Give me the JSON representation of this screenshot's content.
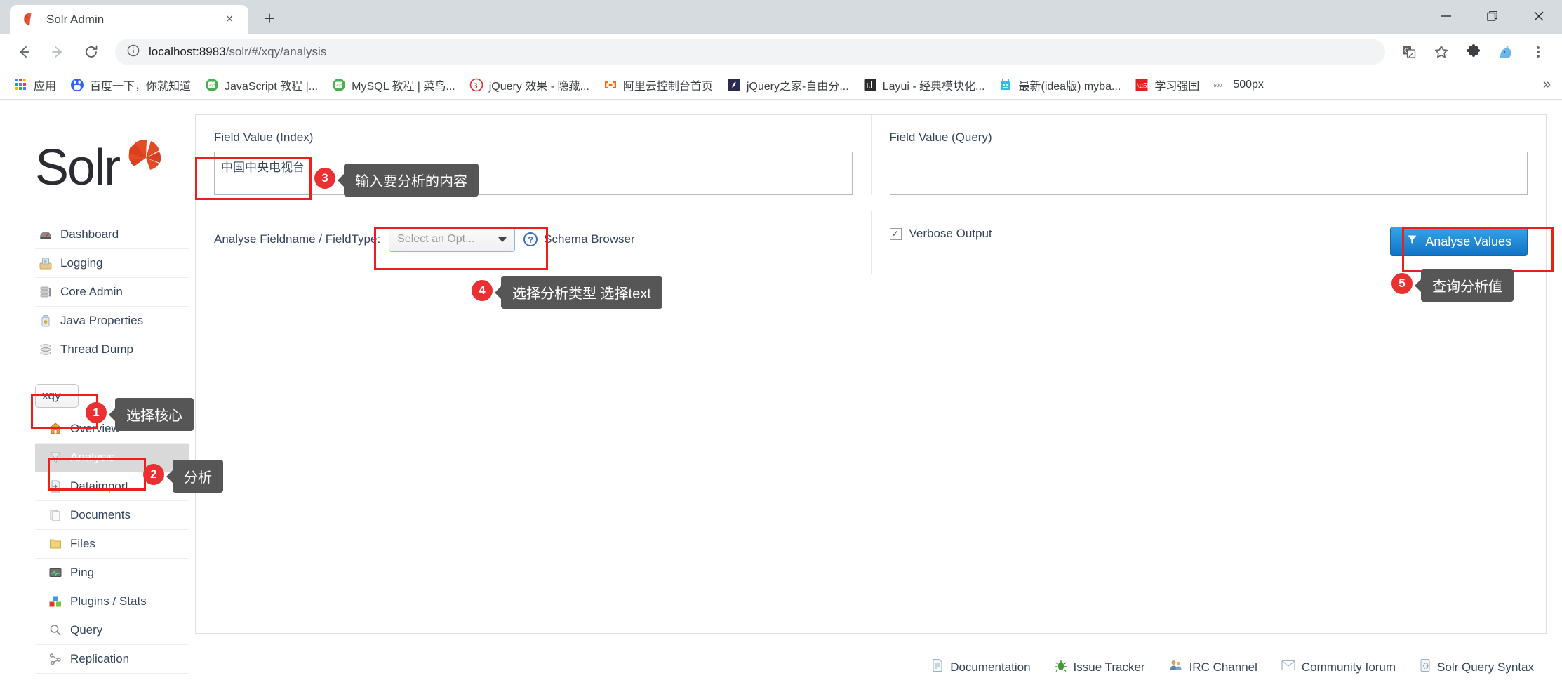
{
  "browser": {
    "tab": {
      "title": "Solr Admin",
      "favicon": "solr-favicon",
      "close_label": "×"
    },
    "newtab_label": "+",
    "window_controls": {
      "minimize": "—",
      "maximize": "❐",
      "close": "✕"
    },
    "nav": {
      "back": "←",
      "forward": "→",
      "reload": "⟳"
    },
    "omnibox": {
      "info_icon": "info-circle-icon",
      "url_host": "localhost:8983",
      "url_path": "/solr/#/xqy/analysis",
      "url_full": "localhost:8983/solr/#/xqy/analysis"
    },
    "toolbar_icons": [
      "translate-icon",
      "bookmark-star-icon",
      "extensions-puzzle-icon",
      "profile-avatar-icon",
      "more-menu-icon"
    ],
    "bookmarks": [
      {
        "label": "应用",
        "icon": "apps-grid-icon"
      },
      {
        "label": "百度一下，你就知道",
        "icon": "baidu-icon"
      },
      {
        "label": "JavaScript 教程 |...",
        "icon": "runoob-icon"
      },
      {
        "label": "MySQL 教程 | 菜鸟...",
        "icon": "runoob-icon"
      },
      {
        "label": "jQuery 效果 - 隐藏...",
        "icon": "w3school-icon"
      },
      {
        "label": "阿里云控制台首页",
        "icon": "aliyun-icon"
      },
      {
        "label": "jQuery之家-自由分...",
        "icon": "jqhome-icon"
      },
      {
        "label": "Layui - 经典模块化...",
        "icon": "layui-icon"
      },
      {
        "label": "最新(idea版) myba...",
        "icon": "mybatis-icon"
      },
      {
        "label": "学习强国",
        "icon": "xuexi-icon"
      },
      {
        "label": "500px",
        "icon": "fivehundredpx-icon"
      }
    ],
    "bookmarks_overflow": "»"
  },
  "solr": {
    "logo_text": "Solr",
    "menu": [
      {
        "label": "Dashboard",
        "icon": "dashboard-icon"
      },
      {
        "label": "Logging",
        "icon": "logging-icon"
      },
      {
        "label": "Core Admin",
        "icon": "core-admin-icon"
      },
      {
        "label": "Java Properties",
        "icon": "java-properties-icon"
      },
      {
        "label": "Thread Dump",
        "icon": "thread-dump-icon"
      }
    ],
    "core_selector": {
      "value": "xqy"
    },
    "core_menu": [
      {
        "label": "Overview",
        "icon": "overview-home-icon",
        "active": false
      },
      {
        "label": "Analysis",
        "icon": "analysis-funnel-icon",
        "active": true
      },
      {
        "label": "Dataimport",
        "icon": "dataimport-icon",
        "active": false
      },
      {
        "label": "Documents",
        "icon": "documents-icon",
        "active": false
      },
      {
        "label": "Files",
        "icon": "files-folder-icon",
        "active": false
      },
      {
        "label": "Ping",
        "icon": "ping-icon",
        "active": false
      },
      {
        "label": "Plugins / Stats",
        "icon": "plugins-stats-icon",
        "active": false
      },
      {
        "label": "Query",
        "icon": "query-magnifier-icon",
        "active": false
      },
      {
        "label": "Replication",
        "icon": "replication-icon",
        "active": false
      }
    ],
    "analysis": {
      "index_label": "Field Value (Index)",
      "index_value": "中国中央电视台",
      "index_placeholder": "",
      "query_label": "Field Value (Query)",
      "query_value": "",
      "query_placeholder": "",
      "analyse_label": "Analyse Fieldname / FieldType:",
      "select_value": "Select an Opt...",
      "schema_browser_label": "Schema Browser",
      "verbose_label": "Verbose Output",
      "verbose_checked": true,
      "analyse_button_label": "Analyse Values"
    },
    "footer_links": [
      {
        "label": "Documentation",
        "icon": "documentation-icon"
      },
      {
        "label": "Issue Tracker",
        "icon": "issue-tracker-bug-icon"
      },
      {
        "label": "IRC Channel",
        "icon": "irc-channel-icon"
      },
      {
        "label": "Community forum",
        "icon": "community-forum-icon"
      },
      {
        "label": "Solr Query Syntax",
        "icon": "solr-query-syntax-icon"
      }
    ]
  },
  "annotations": [
    {
      "number": "1",
      "tip": "选择核心"
    },
    {
      "number": "2",
      "tip": "分析"
    },
    {
      "number": "3",
      "tip": "输入要分析的内容"
    },
    {
      "number": "4",
      "tip": "选择分析类型 选择text"
    },
    {
      "number": "5",
      "tip": "查询分析值"
    }
  ],
  "colors": {
    "annotation_red": "#f01d1d",
    "annotation_badge": "#ea3030",
    "tooltip_bg": "#565656",
    "solr_logo_red": "#d9411e",
    "button_blue": "#1273c6",
    "sidebar_text": "#34465d"
  }
}
